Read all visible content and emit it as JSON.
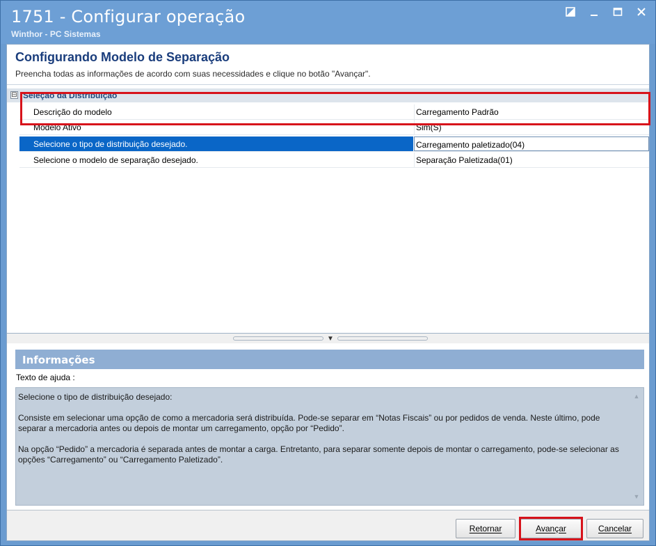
{
  "window": {
    "title": "1751 - Configurar operação",
    "subtitle": "Winthor - PC Sistemas",
    "controls": [
      "restore-icon",
      "minimize-icon",
      "maximize-icon",
      "close-icon"
    ]
  },
  "header": {
    "title": "Configurando Modelo de Separação",
    "description": "Preencha todas as informações de acordo com suas necessidades e clique no botão \"Avançar\"."
  },
  "grid": {
    "category": {
      "expander": "⊟",
      "label": "Seleção da Distribuição"
    },
    "rows": [
      {
        "name": "Descrição do modelo",
        "value": "Carregamento Padrão"
      },
      {
        "name": "Modelo Ativo",
        "value": "Sim(S)"
      },
      {
        "name": "Selecione o tipo de distribuição desejado.",
        "value": "Carregamento paletizado(04)"
      },
      {
        "name": "Selecione o modelo de separação desejado.",
        "value": "Separação Paletizada(01)"
      }
    ],
    "selected_index": 2
  },
  "info": {
    "header": "Informações",
    "help_label": "Texto de ajuda :",
    "help_paragraphs": [
      "Selecione o tipo de distribuição desejado:",
      "Consiste em selecionar uma opção de como a mercadoria será distribuída. Pode-se separar em “Notas Fiscais” ou por pedidos de venda. Neste último, pode separar a mercadoria antes ou depois de montar um carregamento, opção por “Pedido”.",
      "Na opção “Pedido” a mercadoria é separada antes de montar a carga. Entretanto, para separar somente depois de montar o carregamento, pode-se selecionar as opções “Carregamento” ou “Carregamento Paletizado”."
    ]
  },
  "footer": {
    "retornar_label": "Retornar",
    "avancar_label": "Avançar",
    "cancelar_label": "Cancelar"
  },
  "colors": {
    "titlebar": "#6d9fd5",
    "selection": "#0a66c7",
    "highlight": "#d7131b",
    "info_header": "#8faed3",
    "help_bg": "#c3cfdc"
  }
}
